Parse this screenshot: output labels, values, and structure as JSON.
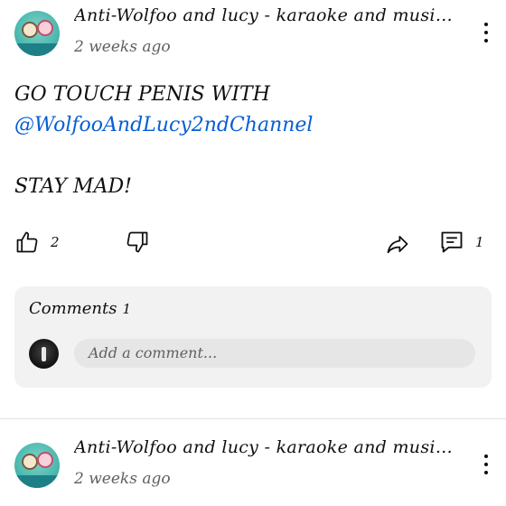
{
  "posts": [
    {
      "channel_name": "Anti-Wolfoo and lucy - karaoke and music...",
      "time_ago": "2 weeks ago",
      "body_lines": [
        "GO TOUCH PENIS WITH",
        "@WolfooAndLucy2ndChannel",
        "",
        "STAY MAD!"
      ],
      "likes": "2",
      "comments_count": "1"
    },
    {
      "channel_name": "Anti-Wolfoo and lucy - karaoke and music...",
      "time_ago": "2 weeks ago"
    }
  ],
  "comments_panel": {
    "title": "Comments",
    "count": "1",
    "input_placeholder": "Add a comment..."
  },
  "icons": {
    "like": "thumbs-up-icon",
    "dislike": "thumbs-down-icon",
    "share": "share-icon",
    "comment": "comment-icon",
    "more": "more-vert-icon"
  },
  "colors": {
    "mention": "#065fd4",
    "panel_bg": "#f2f2f2",
    "input_bg": "#e6e6e6"
  }
}
